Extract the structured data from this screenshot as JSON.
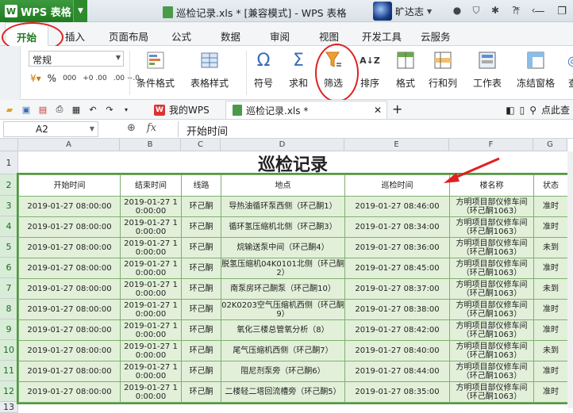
{
  "app": {
    "name": "WPS 表格",
    "doc_title": "巡检记录.xls * [兼容模式] - WPS 表格",
    "user": "旷达志"
  },
  "ribbon_tabs": [
    "开始",
    "插入",
    "页面布局",
    "公式",
    "数据",
    "审阅",
    "视图",
    "开发工具",
    "云服务"
  ],
  "ribbon": {
    "number_format": "常规",
    "percent": "%",
    "comma": "000",
    "inc_decimal": "+0 .00",
    "dec_decimal": ".00 +.0",
    "buttons": [
      "条件格式",
      "表格样式",
      "符号",
      "求和",
      "筛选",
      "排序",
      "格式",
      "行和列",
      "工作表",
      "冻结窗格",
      "查"
    ]
  },
  "doc_tabs": [
    {
      "label": "我的WPS"
    },
    {
      "label": "巡检记录.xls *"
    }
  ],
  "quick_right": "点此查",
  "formula_bar": {
    "cell_ref": "A2",
    "fx": "fx",
    "value": "开始时间"
  },
  "columns": [
    "A",
    "B",
    "C",
    "D",
    "E",
    "F",
    "G"
  ],
  "rows": [
    "1",
    "2",
    "3",
    "4",
    "5",
    "6",
    "7",
    "8",
    "9",
    "10",
    "11",
    "12",
    "13"
  ],
  "sheet": {
    "title": "巡检记录",
    "headers": [
      "开始时间",
      "结束时间",
      "线路",
      "地点",
      "巡检时间",
      "楼名称",
      "状态"
    ],
    "records": [
      [
        "2019-01-27 08:00:00",
        "2019-01-27 10:00:00",
        "环己酮",
        "导热油循环泵西侧（环己酮1）",
        "2019-01-27 08:46:00",
        "方明项目部仪修车间（环己酮1063）",
        "准时"
      ],
      [
        "2019-01-27 08:00:00",
        "2019-01-27 10:00:00",
        "环己酮",
        "循环氢压缩机北侧（环己酮3）",
        "2019-01-27 08:34:00",
        "方明项目部仪修车间（环己酮1063）",
        "准时"
      ],
      [
        "2019-01-27 08:00:00",
        "2019-01-27 10:00:00",
        "环己酮",
        "烷输送泵中间（环己酮4）",
        "2019-01-27 08:36:00",
        "方明项目部仪修车间（环己酮1063）",
        "未到"
      ],
      [
        "2019-01-27 08:00:00",
        "2019-01-27 10:00:00",
        "环己酮",
        "脱氢压缩机04K0101北侧（环己酮2）",
        "2019-01-27 08:45:00",
        "方明项目部仪修车间（环己酮1063）",
        "准时"
      ],
      [
        "2019-01-27 08:00:00",
        "2019-01-27 10:00:00",
        "环己酮",
        "南泵房环己酮泵（环己酮10）",
        "2019-01-27 08:37:00",
        "方明项目部仪修车间（环己酮1063）",
        "未到"
      ],
      [
        "2019-01-27 08:00:00",
        "2019-01-27 10:00:00",
        "环己酮",
        "02K0203空气压缩机西侧（环己酮9）",
        "2019-01-27 08:38:00",
        "方明项目部仪修车间（环己酮1063）",
        "准时"
      ],
      [
        "2019-01-27 08:00:00",
        "2019-01-27 10:00:00",
        "环己酮",
        "氧化三楼总管氧分析（8）",
        "2019-01-27 08:42:00",
        "方明项目部仪修车间（环己酮1063）",
        "准时"
      ],
      [
        "2019-01-27 08:00:00",
        "2019-01-27 10:00:00",
        "环己酮",
        "尾气压缩机西侧（环己酮7）",
        "2019-01-27 08:40:00",
        "方明项目部仪修车间（环己酮1063）",
        "未到"
      ],
      [
        "2019-01-27 08:00:00",
        "2019-01-27 10:00:00",
        "环己酮",
        "阻尼剂泵旁（环己酮6）",
        "2019-01-27 08:44:00",
        "方明项目部仪修车间（环己酮1063）",
        "准时"
      ],
      [
        "2019-01-27 08:00:00",
        "2019-01-27 10:00:00",
        "环己酮",
        "二楼轻二塔回流槽旁（环己酮5）",
        "2019-01-27 08:35:00",
        "方明项目部仪修车间（环己酮1063）",
        "准时"
      ]
    ]
  },
  "colors": {
    "accent": "#1f7a1f",
    "highlight": "#e02020",
    "cell_fill": "#e2f0d9"
  }
}
